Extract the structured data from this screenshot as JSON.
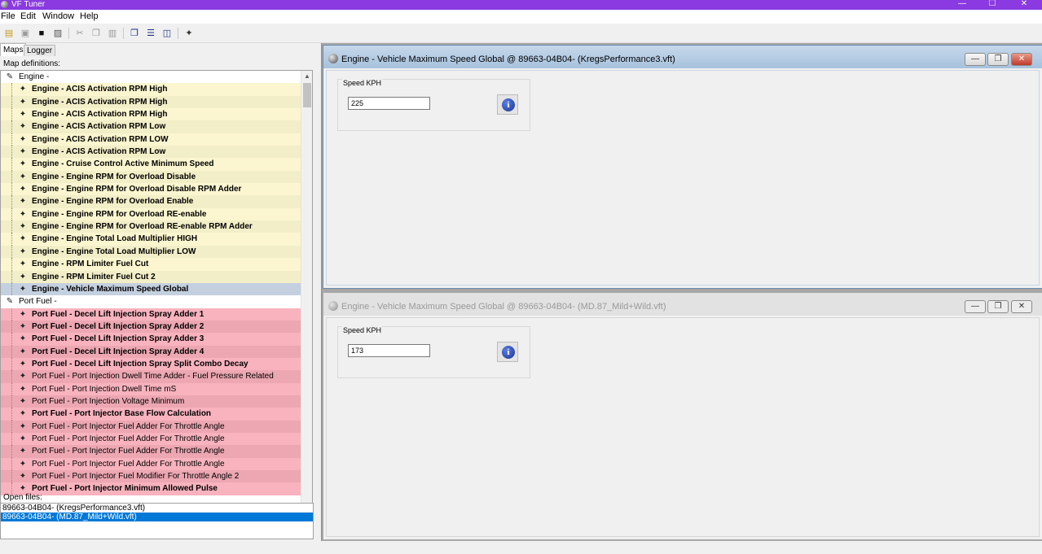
{
  "app": {
    "title": "VF Tuner"
  },
  "window_controls": {
    "minimize": "—",
    "maximize": "☐",
    "close": "✕"
  },
  "menu": [
    "File",
    "Edit",
    "Window",
    "Help"
  ],
  "left": {
    "tabs": [
      "Maps",
      "Logger"
    ],
    "map_definitions_label": "Map definitions:",
    "open_files_label": "Open files:",
    "tree": [
      {
        "label": "Engine -",
        "type": "group"
      },
      {
        "label": "Engine - ACIS Activation RPM High",
        "bold": true
      },
      {
        "label": "Engine - ACIS Activation RPM High",
        "bold": true
      },
      {
        "label": "Engine - ACIS Activation RPM High",
        "bold": true
      },
      {
        "label": "Engine - ACIS Activation RPM Low",
        "bold": true
      },
      {
        "label": "Engine - ACIS Activation RPM LOW",
        "bold": true
      },
      {
        "label": "Engine - ACIS Activation RPM Low",
        "bold": true
      },
      {
        "label": "Engine - Cruise Control Active Minimum Speed",
        "bold": true
      },
      {
        "label": "Engine - Engine RPM for Overload Disable",
        "bold": true
      },
      {
        "label": "Engine - Engine RPM for Overload Disable RPM Adder",
        "bold": true
      },
      {
        "label": "Engine - Engine RPM for Overload Enable",
        "bold": true
      },
      {
        "label": "Engine - Engine RPM for Overload RE-enable",
        "bold": true
      },
      {
        "label": "Engine - Engine RPM for Overload RE-enable RPM Adder",
        "bold": true
      },
      {
        "label": "Engine - Engine Total Load Multiplier HIGH",
        "bold": true
      },
      {
        "label": "Engine - Engine Total Load Multiplier LOW",
        "bold": true
      },
      {
        "label": "Engine - RPM Limiter Fuel Cut",
        "bold": true
      },
      {
        "label": "Engine - RPM Limiter Fuel Cut 2",
        "bold": true
      },
      {
        "label": "Engine - Vehicle Maximum Speed Global",
        "bold": true,
        "selected": true
      },
      {
        "label": "Port Fuel -",
        "type": "group"
      },
      {
        "label": "Port Fuel - Decel Lift Injection Spray Adder 1",
        "bold": true
      },
      {
        "label": "Port Fuel - Decel Lift Injection Spray Adder 2",
        "bold": true
      },
      {
        "label": "Port Fuel - Decel Lift Injection Spray Adder 3",
        "bold": true
      },
      {
        "label": "Port Fuel - Decel Lift Injection Spray Adder 4",
        "bold": true
      },
      {
        "label": "Port Fuel - Decel Lift Injection Spray Split Combo Decay",
        "bold": true
      },
      {
        "label": "Port Fuel - Port Injection Dwell Time Adder - Fuel Pressure Related",
        "bold": false
      },
      {
        "label": "Port Fuel - Port Injection Dwell Time mS",
        "bold": false
      },
      {
        "label": "Port Fuel - Port Injection Voltage Minimum",
        "bold": false
      },
      {
        "label": "Port Fuel - Port Injector Base Flow Calculation",
        "bold": true
      },
      {
        "label": "Port Fuel - Port Injector Fuel Adder For Throttle Angle",
        "bold": false
      },
      {
        "label": "Port Fuel - Port Injector Fuel Adder For Throttle Angle",
        "bold": false
      },
      {
        "label": "Port Fuel - Port Injector Fuel Adder For Throttle Angle",
        "bold": false
      },
      {
        "label": "Port Fuel - Port Injector Fuel Adder For Throttle Angle",
        "bold": false
      },
      {
        "label": "Port Fuel - Port Injector Fuel Modifier For Throttle Angle 2",
        "bold": false
      },
      {
        "label": "Port Fuel - Port Injector Minimum Allowed Pulse",
        "bold": true
      }
    ],
    "open_files": [
      {
        "label": "89663-04B04- (KregsPerformance3.vft)",
        "selected": false
      },
      {
        "label": "89663-04B04- (MD.87_Mild+Wild.vft)",
        "selected": true
      }
    ]
  },
  "windows": [
    {
      "title": "Engine - Vehicle Maximum Speed Global @ 89663-04B04- (KregsPerformance3.vft)",
      "active": true,
      "group_label": "Speed KPH",
      "value": "225"
    },
    {
      "title": "Engine - Vehicle Maximum Speed Global @ 89663-04B04- (MD.87_Mild+Wild.vft)",
      "active": false,
      "group_label": "Speed KPH",
      "value": "173"
    }
  ]
}
